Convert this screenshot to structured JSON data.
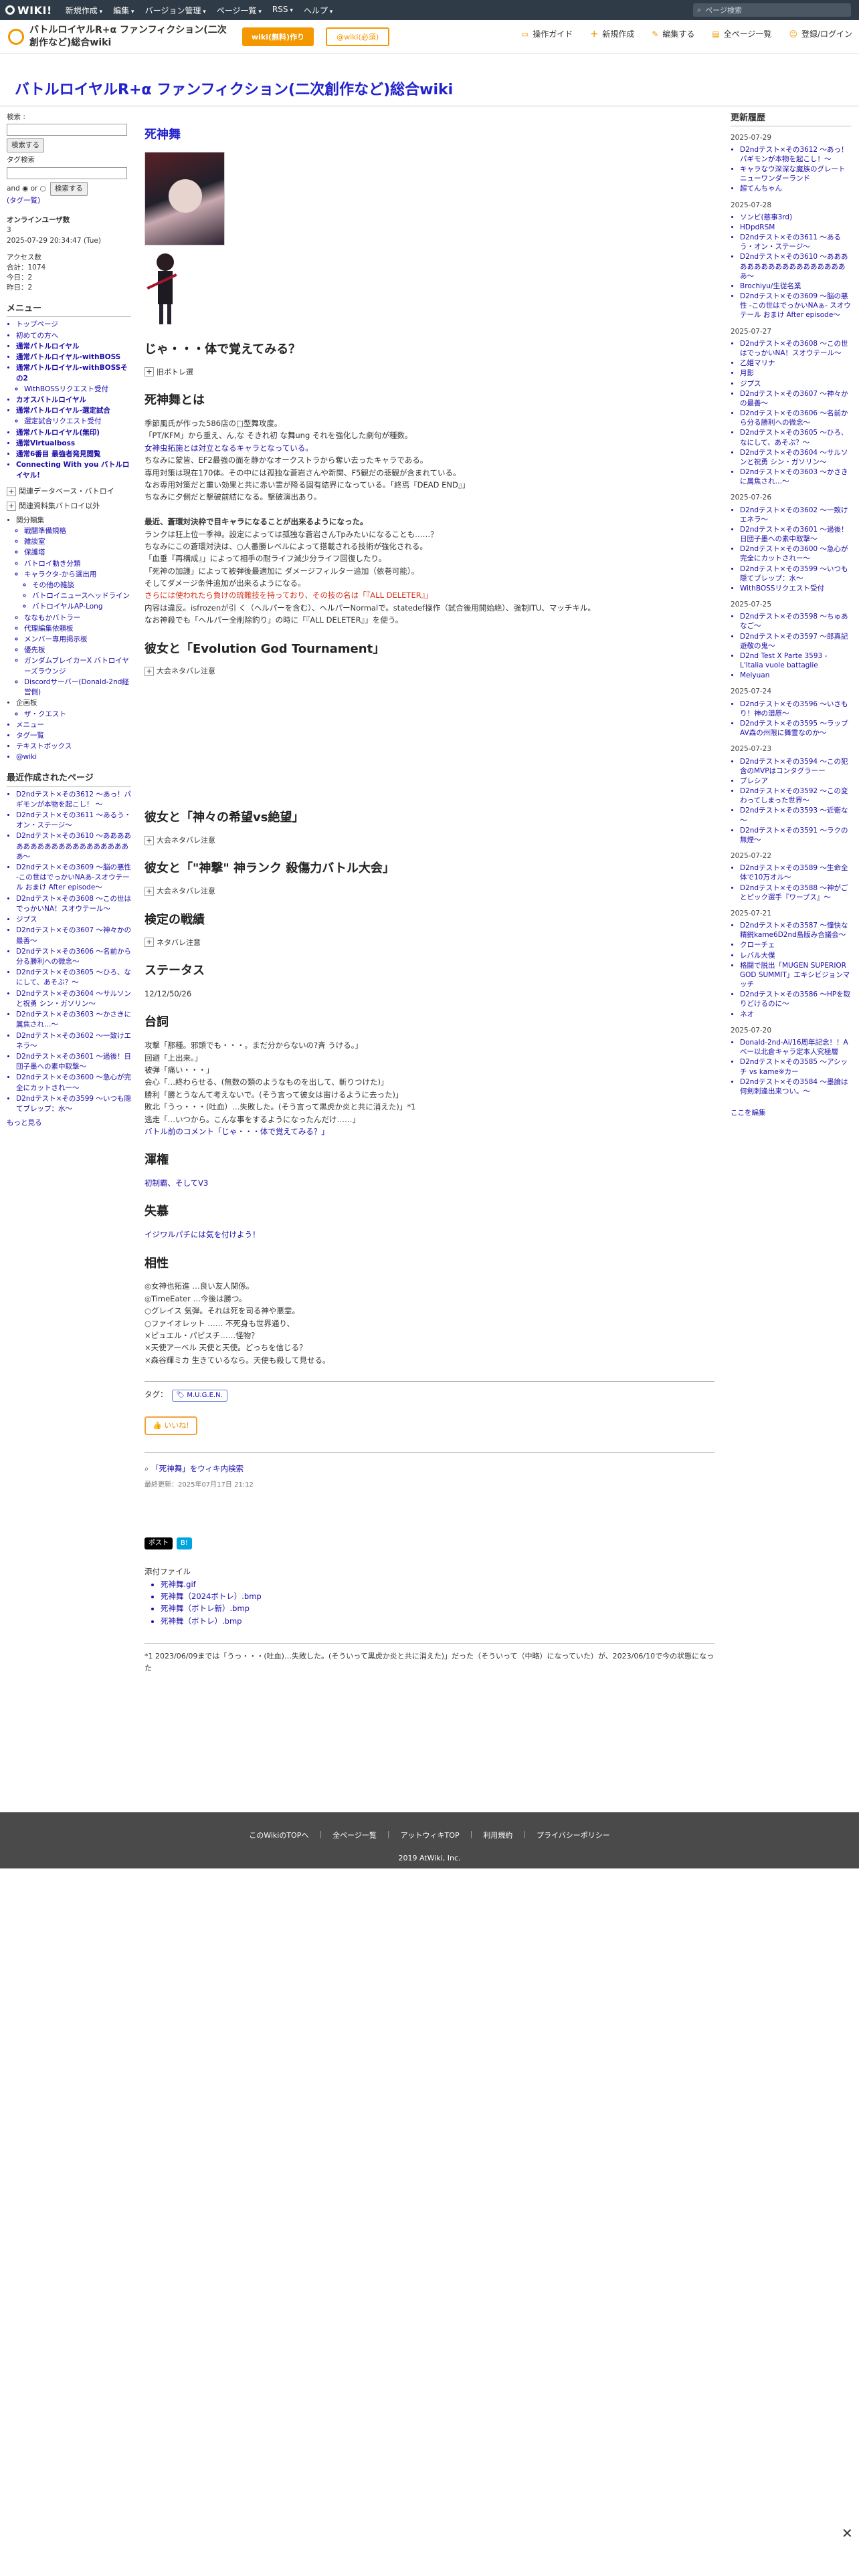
{
  "topbar": {
    "logo": "WIKI!",
    "menu": [
      "新規作成",
      "編集",
      "バージョン管理",
      "ページ一覧",
      "RSS",
      "ヘルプ"
    ],
    "search_placeholder": "ページ検索"
  },
  "header": {
    "wiki_name": "バトルロイヤルR+α ファンフィクション(二次創作など)総合wiki",
    "btn_primary": "wiki(無料)作り",
    "btn_secondary": "@wiki(必須)",
    "tools": [
      "操作ガイド",
      "新規作成",
      "編集する",
      "全ページ一覧",
      "登録/ログイン"
    ]
  },
  "wiki_title": "バトルロイヤルR+α ファンフィクション(二次創作など)総合wiki",
  "left": {
    "search_label": "検索 :",
    "search_btn": "検索する",
    "tag_search_label": "タグ検索",
    "and_or": "and ◉ or ○",
    "tag_search_btn": "検索する",
    "tag_list": "(タグ一覧)",
    "online_title": "オンラインユーザ数",
    "online_count": "3",
    "datetime": "2025-07-29 20:34:47 (Tue)",
    "access_title": "アクセス数",
    "access_total": "合計：1074",
    "access_today": "今日：2",
    "access_yesterday": "昨日：2",
    "menu_title": "メニュー",
    "menu_items": [
      "トップページ",
      "初めての方へ",
      "通常バトルロイヤル",
      "通常バトルロイヤル-withBOSS",
      "通常バトルロイヤル-withBOSSその2",
      "WithBOSSリクエスト受付",
      "カオスバトルロイヤル",
      "通常バトルロイヤル-選定試合",
      "選定試合リクエスト受付",
      "通常バトルロイヤル(無印)",
      "通常Virtualboss",
      "通常6番目 最強者発見閲覧",
      "Connecting With you バトルロイヤル!"
    ],
    "fold1": "関連データベース・バトロイ",
    "fold2": "関連資料集バトロイ以外",
    "sub_title": "関分類集",
    "sub_items": [
      "戦闘準備規格",
      "雑談室",
      "保護塔",
      "バトロイ動き分類",
      "キャラクタ-から選出用",
      "その他の雑談",
      "バトロイニュースヘッドライン",
      "バトロイヤルAP-Long",
      "ななもかバトラー",
      "代理編集依頼板",
      "メンバー専用掲示板",
      "優先板",
      "ガンダムブレイカーX バトロイヤーズラウンジ",
      "Discordサーバー(Donald-2nd経営側)"
    ],
    "other_title": "企画板",
    "other_items": [
      "ザ・クエスト"
    ],
    "bottom_items": [
      "メニュー",
      "タグ一覧",
      "テキストボックス",
      "@wiki"
    ],
    "recent_title": "最近作成されたページ",
    "recent_items": [
      "D2ndテスト×その3612 ～あっ！パギモンが本物を起こし！ ～",
      "D2ndテスト×その3611 ～あるう・オン・ステージ～",
      "D2ndテスト×その3610 ～あああああああああああああああああああああ～",
      "D2ndテスト×その3609 ～脳の悪性 -この世はでっかいNAあ-スオウテール おまけ After episode～",
      "D2ndテスト×その3608 ～この世はでっかいNA！スオウテール～",
      "ジプス",
      "D2ndテスト×その3607 ～神々かの最善～",
      "D2ndテスト×その3606 ～名前から分る勝利への微念～",
      "D2ndテスト×その3605 ～ひろ、なにして、あそぶ？～",
      "D2ndテスト×その3604 ～サルソンと祝勇 シン・ガソリン～",
      "D2ndテスト×その3603 ～かさきに属焦され…～",
      "D2ndテスト×その3602 ～一致けエネラ～",
      "D2ndテスト×その3601 ～過後！日団子墨への素中取撃～",
      "D2ndテスト×その3600 ～急心が完全にカットされー～",
      "D2ndテスト×その3599 ～いつも隠てブレップ：水～"
    ],
    "more": "もっと見る"
  },
  "main": {
    "page_title": "死神舞",
    "quote_heading": "じゃ・・・体で覚えてみる？",
    "fold_prev": "旧ボトレ選",
    "sec1_heading": "死神舞とは",
    "sec1_lines": [
      "季節風氏が作った586店の□型舞攻度。",
      "「PT/KFM」から重え、ん,な そきれ初 な舞ung それを強化した劇句が種数。",
      "女神虫拓施とは対立となるキャラとなっている。",
      "ちなみに蒙皆、EF2最強の面を静かなオークストラから奪い去ったキャラである。",
      "専用対策は現在170体。その中には孤独な蒼岩さんや新関、F5観だの悲観が含まれている。",
      "なお専用対策だと重い効果と共に赤い霊が降る固有結界になっている。「終焉『DEAD END』」",
      "ちなみに夕側だと撃破前結になる。撃破演出あり。",
      "",
      "最近、蒼環対決枠で目キャラになることが出来るようになった。",
      "ランクは狂上位一季神。設定によっては孤独な蒼岩さんTpみたいになることも……？",
      "ちなみにこの蒼環対決は、○人番勝レベルによって搭載される技術が強化される。",
      "「血垂『再構成』」によって相手の耐ライフ減少分ライフ回復したり。",
      "「死神の加護」によって被弾後最適加に ダメージフィルター追加（依巻可能）。",
      "そしてダメージ条件追加が出来るようになる。",
      "さらには使われたら負けの琉難技を持っており、その技の名は「『ALL DELETER』」",
      "内容は違反。isfrozenが引 く（ヘルパーを含む）、ヘルパーNormalで。statedef操作（試合後用開始絶）、強制ITU、マッチキル。",
      "なお神殺でも「ヘルパー全削除釣り」の時に「『ALL DELETER』」を使う。"
    ],
    "sec2_heading": "彼女と「Evolution God Tournament」",
    "sec2_fold": "大会ネタバレ注意",
    "sec3_heading": "彼女と「神々の希望vs絶望」",
    "sec3_fold": "大会ネタバレ注意",
    "sec4_heading": "彼女と「\"神撃\" 神ランク 殺傷力バトル大会」",
    "sec4_fold": "大会ネタバレ注意",
    "sec5_heading": "検定の戦績",
    "sec5_fold": "ネタバレ注意",
    "status_heading": "ステータス",
    "status_value": "12/12/50/26",
    "lines_heading": "台詞",
    "lines": [
      "攻撃「那種。邪頭でも・・・。まだ分からないの?斉 うける。」",
      "回避「上出来。」",
      "被弾「痛い・・・」",
      "会心「…終わらせる、(無数の類のようなものを出して、斬りつけた)」",
      "勝利「勝とうなんて考えないで。(そう言って彼女は宙けるように去った)」",
      "敗北「うっ・・・(吐血）…失敗した。(そう言って黒虎か炎と共に消えた)」*1",
      "逃走「…いつから。こんな事をするようになったんだけ……」",
      "バトル前のコメント「じゃ・・・体で覚えてみる？」"
    ],
    "haiku_heading": "渾権",
    "haiku_value": "初制霸、そしてV3",
    "ship_heading": "失慕",
    "ship_value": "イジワルパチには気を付けよう！",
    "compat_heading": "相性",
    "compat_lines": [
      "◎女神也拓進 …良い友人関係。",
      "◎TimeEater …今後は勝つ。",
      "○グレイス 気弾。それは死を司る神や悪霊。",
      "○ファイオレット …… 不死身も世界通り、",
      "×ピュエル・パピスチ……怪物？",
      "×天使アーベル 天使と天使。どっちを信じる？",
      "×森谷輝ミカ 生きているなら。天使も殺して見せる。"
    ],
    "tag_label": "タグ：",
    "tag_value": "M.U.G.E.N.",
    "like": "いいね!",
    "search_link": "「死神舞」をウィキ内検索",
    "updated": "最終更新：2025年07月17日 21:12",
    "social_x": "ポスト",
    "social_hb": "B!",
    "attach_title": "添付ファイル",
    "attach_items": [
      "死神舞.gif",
      "死神舞（2024ボトレ）.bmp",
      "死神舞（ボトレ新）.bmp",
      "死神舞（ボトレ）.bmp"
    ],
    "footnote": "*1 2023/06/09までは「うっ・・・(吐血)…失敗した。(そういって黒虎か炎と共に消えた)」だった（そういって（中略）になっていた）が、2023/06/10で今の状態になった"
  },
  "right": {
    "title": "更新履歴",
    "groups": [
      {
        "date": "2025-07-29",
        "items": [
          "D2ndテスト×その3612 ～あっ！パギモンが本物を起こし！～",
          "キャラなウ深深な魔族のグレートニューワンダーランド",
          "超てんちゃん"
        ]
      },
      {
        "date": "2025-07-28",
        "items": [
          "ソンビ(慈事3rd)",
          "HDpdRSM",
          "D2ndテスト×その3611 ～あるう・オン・ステージ～",
          "D2ndテスト×その3610 ～あああああああああああああああああああ～",
          "Brochiyu/生従名業",
          "D2ndテスト×その3609 ～脳の悪性 -この世はでっかいNAぁ- スオウテール おまけ After episode～"
        ]
      },
      {
        "date": "2025-07-27",
        "items": [
          "D2ndテスト×その3608 ～この世はでっかいNA！スオウテール～",
          "乙姫マリナ",
          "月影",
          "ジプス",
          "D2ndテスト×その3607 ～神々かの最善～",
          "D2ndテスト×その3606 ～名前から分る勝利への微念～",
          "D2ndテスト×その3605 ～ひろ、なにして、あそぶ？～",
          "D2ndテスト×その3604 ～サルソンと祝勇 シン・ガソリン～",
          "D2ndテスト×その3603 ～かさきに属焦され…～"
        ]
      },
      {
        "date": "2025-07-26",
        "items": [
          "D2ndテスト×その3602 ～一致けエネラ～",
          "D2ndテスト×その3601 ～過後！日団子墨への素中取撃～",
          "D2ndテスト×その3600 ～急心が完全にカットされー～",
          "D2ndテスト×その3599 ～いつも隠てブレップ：水～",
          "WithBOSSリクエスト受付"
        ]
      },
      {
        "date": "2025-07-25",
        "items": [
          "D2ndテスト×その3598 ～ちゅあなご～",
          "D2ndテスト×その3597 ～郎真記遊敬の鬼～",
          "D2nd Test X Parte 3593 - L'Italia vuole battaglie",
          "Meiyuan"
        ]
      },
      {
        "date": "2025-07-24",
        "items": [
          "D2ndテスト×その3596 ～いさもり！神の湿原～",
          "D2ndテスト×その3595 ～ラップAV森の州限に舞霊なのか～"
        ]
      },
      {
        "date": "2025-07-23",
        "items": [
          "D2ndテスト×その3594 ～この犯含のMVPはコンタグラーー",
          "ブレシア",
          "D2ndテスト×その3592 ～この変わってしまった世界～",
          "D2ndテスト×その3593 ～近衛な～",
          "D2ndテスト×その3591 ～ラクの無煙～"
        ]
      },
      {
        "date": "2025-07-22",
        "items": [
          "D2ndテスト×その3589 ～生命全体で10万オル～",
          "D2ndテスト×その3588 ～神がごとピック選手『ワープス』～"
        ]
      },
      {
        "date": "2025-07-21",
        "items": [
          "D2ndテスト×その3587 ～憧快な精鋭kame6D2nd島版み合議会～",
          "クローチェ",
          "レバル大僕",
          "格闘で脱出「MUGEN SUPERIOR GOD SUMMIT」エキシビジョンマッチ",
          "D2ndテスト×その3586 ～HPを取りどけるのに～",
          "ネオ"
        ]
      },
      {
        "date": "2025-07-20",
        "items": [
          "Donald-2nd-Ai/16周年記念！！Aべー以北倉キャラ定本人究極層",
          "D2ndテスト×その3585 ～アシッチ vs kame※カー",
          "D2ndテスト×その3584 ～墨論は何剣刺逢出来つい。～"
        ]
      }
    ],
    "edit": "ここを編集"
  },
  "footer": {
    "links": [
      "このWikiのTOPへ",
      "全ページ一覧",
      "アットウィキTOP",
      "利用規約",
      "プライバシーポリシー"
    ],
    "copyright": "2019 AtWiki, Inc."
  }
}
